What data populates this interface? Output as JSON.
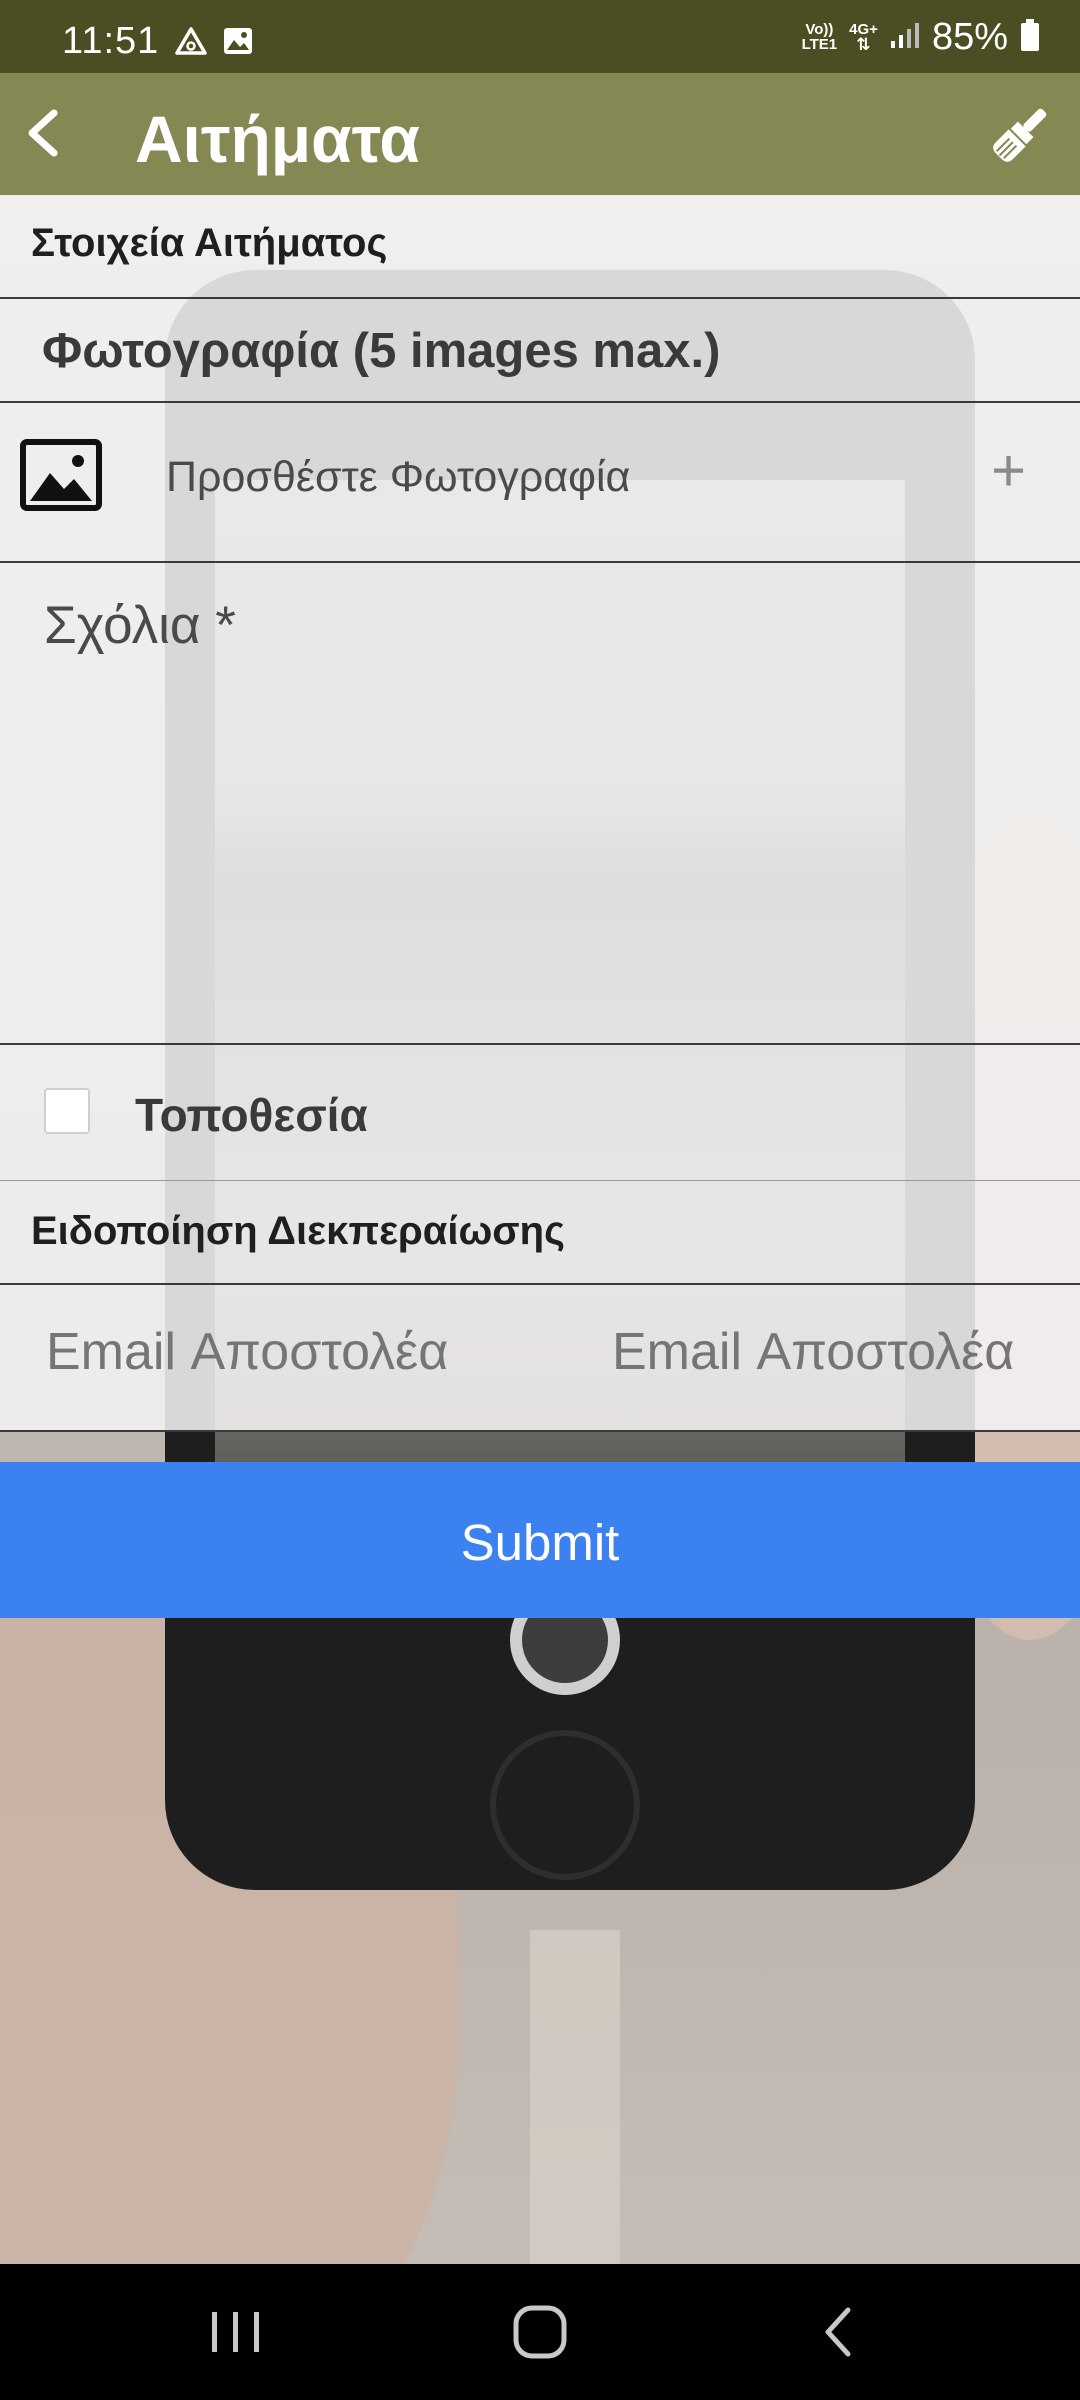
{
  "status_bar": {
    "time": "11:51",
    "network_top": "Vo))",
    "network_bottom": "LTE1",
    "net_type_top": "4G+",
    "battery": "85%",
    "bg_color": "#4a4e22"
  },
  "app_bar": {
    "title": "Αιτήματα",
    "back_icon": "arrow-back-icon",
    "action_icon": "paint-brush-icon",
    "bg_color": "#858853"
  },
  "form": {
    "section_details": "Στοιχεία Αιτήματος",
    "photo_title": "Φωτογραφία (5 images max.)",
    "add_photo_label": "Προσθέστε Φωτογραφία",
    "add_icon": "+",
    "comments_placeholder": "Σχόλια *",
    "location_label": "Τοποθεσία",
    "location_checked": false,
    "notification_section": "Ειδοποίηση Διεκπεραίωσης",
    "email_placeholder_left": "Email Αποστολέα",
    "email_placeholder_right": "Email Αποστολέα"
  },
  "submit": {
    "label": "Submit",
    "color": "#3b82f0"
  },
  "nav_bar": {
    "recents_icon": "recents-icon",
    "home_icon": "home-icon",
    "back_icon": "nav-back-icon"
  }
}
